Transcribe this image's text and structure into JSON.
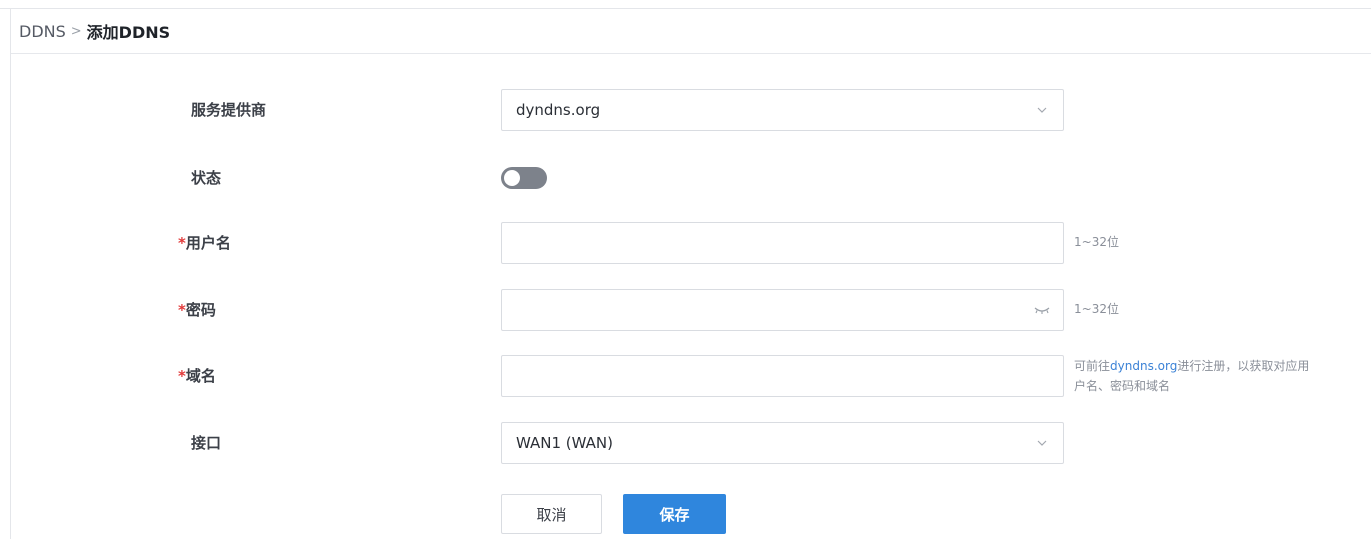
{
  "breadcrumb": {
    "parent": "DDNS",
    "separator": ">",
    "current": "添加DDNS"
  },
  "form": {
    "provider": {
      "label": "服务提供商",
      "value": "dyndns.org"
    },
    "status": {
      "label": "状态",
      "enabled": false
    },
    "username": {
      "required_mark": "*",
      "label": "用户名",
      "value": "",
      "hint": "1~32位"
    },
    "password": {
      "required_mark": "*",
      "label": "密码",
      "value": "",
      "hint": "1~32位"
    },
    "domain": {
      "required_mark": "*",
      "label": "域名",
      "value": "",
      "hint_prefix": "可前往",
      "hint_link": "dyndns.org",
      "hint_suffix": "进行注册，以获取对应用",
      "hint_line2": "户名、密码和域名"
    },
    "interface": {
      "label": "接口",
      "value": "WAN1 (WAN)"
    }
  },
  "actions": {
    "cancel_label": "取消",
    "save_label": "保存"
  },
  "colors": {
    "primary": "#2f86dd",
    "required": "#e23b3b",
    "link": "#3b82d6",
    "toggle_off": "#7d828b"
  }
}
